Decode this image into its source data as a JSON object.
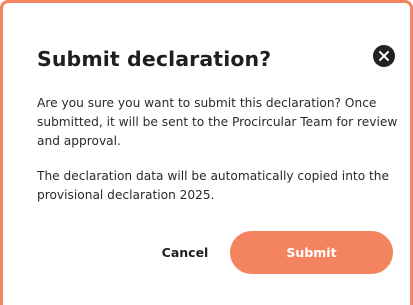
{
  "dialog": {
    "title": "Submit declaration?",
    "close_icon": "close-icon",
    "paragraph_1": "Are you sure you want to submit this declaration? Once submitted, it will be sent to the Procircular Team for review and approval.",
    "paragraph_2": "The declaration data will be automatically copied into the provisional declaration 2025.",
    "cancel_label": "Cancel",
    "submit_label": "Submit"
  },
  "colors": {
    "accent": "#f4845f",
    "text": "#1f1f1f",
    "close_bg": "#222222"
  }
}
